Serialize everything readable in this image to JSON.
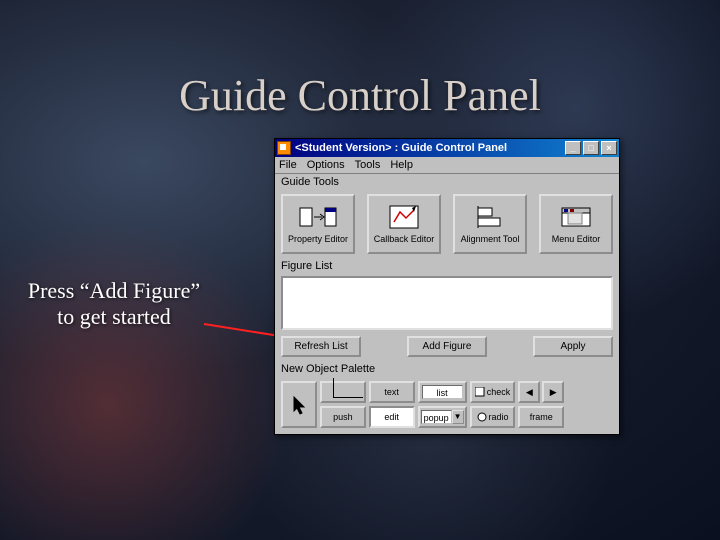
{
  "slide": {
    "title": "Guide Control Panel",
    "annotation_line1": "Press “Add Figure”",
    "annotation_line2": "to get started"
  },
  "window": {
    "title": "<Student Version> : Guide Control Panel",
    "menus": {
      "file": "File",
      "options": "Options",
      "tools": "Tools",
      "help": "Help"
    },
    "sections": {
      "guide_tools": "Guide Tools",
      "figure_list": "Figure List",
      "palette": "New Object Palette"
    },
    "tools": {
      "property_editor": "Property Editor",
      "callback_editor": "Callback Editor",
      "alignment_tool": "Alignment Tool",
      "menu_editor": "Menu Editor"
    },
    "buttons": {
      "refresh": "Refresh List",
      "add_figure": "Add Figure",
      "apply": "Apply"
    },
    "palette": {
      "axes": "axes",
      "text": "text",
      "listbox": "list",
      "check": "check",
      "slider_left": "◀",
      "slider_right": "▶",
      "push": "push",
      "edit": "edit",
      "popup": "popup",
      "popup_arrow": "▼",
      "radio": "radio",
      "frame": "frame"
    },
    "win_controls": {
      "min": "_",
      "max": "□",
      "close": "×"
    }
  }
}
